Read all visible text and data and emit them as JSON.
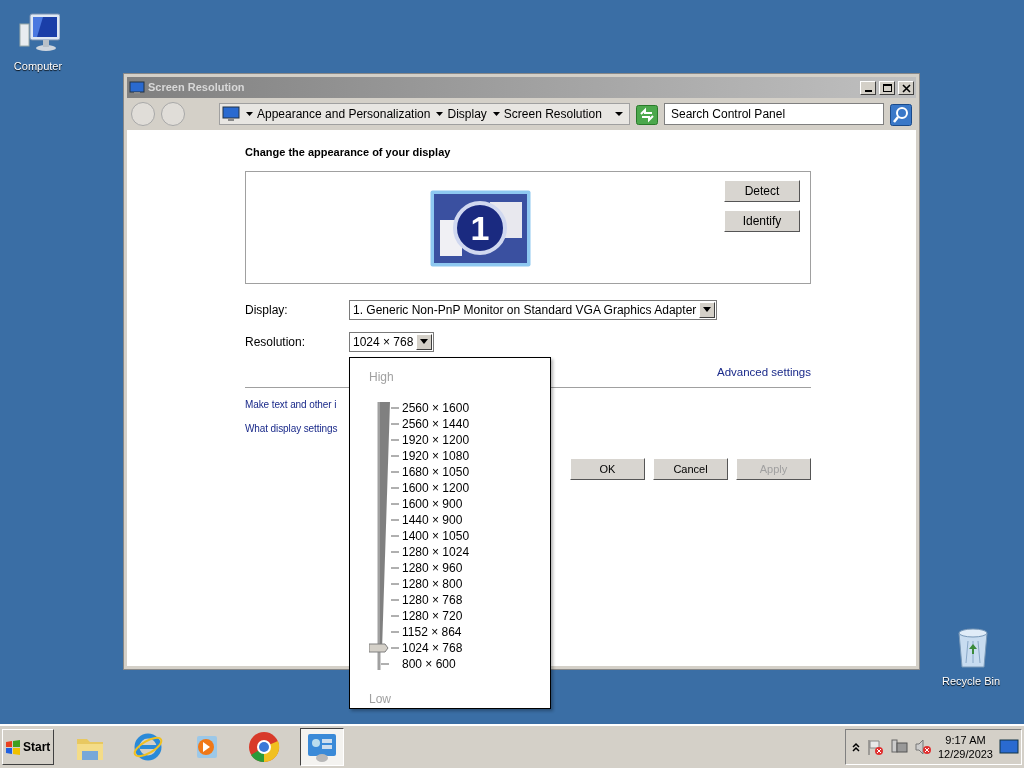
{
  "desktop_icons": [
    {
      "kind": "computer",
      "label": "Computer"
    },
    {
      "kind": "recycle-bin",
      "label": "Recycle Bin"
    }
  ],
  "window": {
    "title": "Screen Resolution"
  },
  "address_bar": {
    "breadcrumbs": [
      "Appearance and Personalization",
      "Display",
      "Screen Resolution"
    ]
  },
  "search": {
    "placeholder": "Search Control Panel"
  },
  "heading": "Change the appearance of your display",
  "monitor": {
    "number": "1"
  },
  "preview_buttons": [
    "Detect",
    "Identify"
  ],
  "display": {
    "label": "Display:",
    "value": "1. Generic Non-PnP Monitor on Standard VGA Graphics Adapter"
  },
  "resolution": {
    "label": "Resolution:",
    "value": "1024 × 768",
    "expanded": true
  },
  "advanced_link": "Advanced settings",
  "links": [
    "Make text and other i",
    "What display settings"
  ],
  "dialog_buttons": [
    {
      "label": "OK",
      "disabled": false
    },
    {
      "label": "Cancel",
      "disabled": false
    },
    {
      "label": "Apply",
      "disabled": true
    }
  ],
  "resolution_menu": {
    "high_label": "High",
    "low_label": "Low",
    "options": [
      {
        "label": "2560 × 1600",
        "selected": false
      },
      {
        "label": "2560 × 1440",
        "selected": false
      },
      {
        "label": "1920 × 1200",
        "selected": false
      },
      {
        "label": "1920 × 1080",
        "selected": false
      },
      {
        "label": "1680 × 1050",
        "selected": false
      },
      {
        "label": "1600 × 1200",
        "selected": false
      },
      {
        "label": "1600 × 900",
        "selected": false
      },
      {
        "label": "1440 × 900",
        "selected": false
      },
      {
        "label": "1400 × 1050",
        "selected": false
      },
      {
        "label": "1280 × 1024",
        "selected": false
      },
      {
        "label": "1280 × 960",
        "selected": false
      },
      {
        "label": "1280 × 800",
        "selected": false
      },
      {
        "label": "1280 × 768",
        "selected": false
      },
      {
        "label": "1280 × 720",
        "selected": false
      },
      {
        "label": "1152 × 864",
        "selected": false
      },
      {
        "label": "1024 × 768",
        "selected": true
      },
      {
        "label": "800 × 600",
        "selected": false
      }
    ]
  },
  "taskbar": {
    "start": "Start",
    "apps": [
      {
        "kind": "folder",
        "active": false
      },
      {
        "kind": "browser-e",
        "active": false
      },
      {
        "kind": "media",
        "active": false
      },
      {
        "kind": "chrome",
        "active": false
      },
      {
        "kind": "control-panel",
        "active": true
      }
    ]
  },
  "clock": {
    "time": "9:17 AM",
    "date": "12/29/2023"
  }
}
